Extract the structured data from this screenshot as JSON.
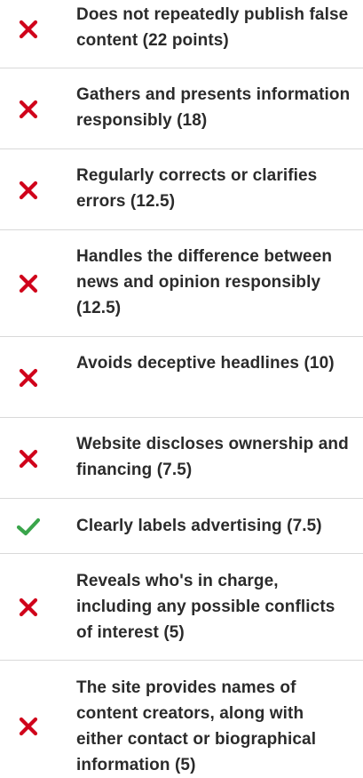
{
  "colors": {
    "fail": "#d0021b",
    "pass": "#3aa54b",
    "text": "#2b2b2b",
    "divider": "#d9d9d9"
  },
  "criteria": [
    {
      "status": "fail",
      "icon": "x-icon",
      "label": "Does not repeatedly publish false content (22 points)"
    },
    {
      "status": "fail",
      "icon": "x-icon",
      "label": "Gathers and presents information responsibly (18)"
    },
    {
      "status": "fail",
      "icon": "x-icon",
      "label": "Regularly corrects or clarifies errors (12.5)"
    },
    {
      "status": "fail",
      "icon": "x-icon",
      "label": "Handles the difference between news and opinion responsibly (12.5)"
    },
    {
      "status": "fail",
      "icon": "x-icon",
      "label": "Avoids deceptive headlines (10)"
    },
    {
      "status": "fail",
      "icon": "x-icon",
      "label": "Website discloses ownership and financing (7.5)"
    },
    {
      "status": "pass",
      "icon": "check-icon",
      "label": "Clearly labels advertising (7.5)"
    },
    {
      "status": "fail",
      "icon": "x-icon",
      "label": "Reveals who's in charge, including any possible conflicts of interest (5)"
    },
    {
      "status": "fail",
      "icon": "x-icon",
      "label": "The site provides names of content creators, along with either contact or biographical information (5)"
    }
  ]
}
